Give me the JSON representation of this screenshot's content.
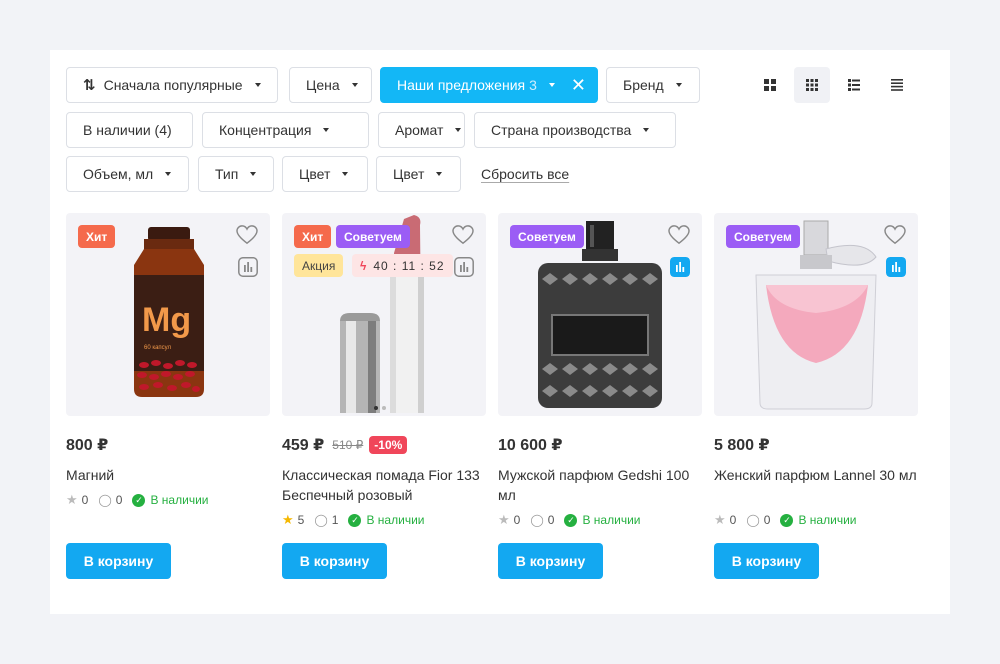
{
  "filters": {
    "sort": "Сначала популярные",
    "price": "Цена",
    "offers": "Наши предложения",
    "offers_count": "3",
    "brand": "Бренд",
    "in_stock": "В наличии (4)",
    "concentration": "Концентрация",
    "aroma": "Аромат",
    "country": "Страна производства",
    "volume": "Объем, мл",
    "type": "Тип",
    "color1": "Цвет",
    "color2": "Цвет",
    "reset": "Сбросить все"
  },
  "view_modes": [
    "grid-large",
    "grid-small",
    "list",
    "compact-list"
  ],
  "accent_color": "#13a8f1",
  "products": [
    {
      "badges": [
        "Хит"
      ],
      "price": "800 ₽",
      "name": "Магний",
      "rating": "0",
      "reviews": "0",
      "stock": "В наличии",
      "cart": "В корзину"
    },
    {
      "badges": [
        "Хит",
        "Советуем"
      ],
      "promo": "Акция",
      "timer": "40 : 11 : 52",
      "price": "459 ₽",
      "old_price": "510 ₽",
      "discount": "-10%",
      "name": "Классическая помада Fior 133 Беспечный розовый",
      "rating": "5",
      "reviews": "1",
      "stock": "В наличии",
      "cart": "В корзину"
    },
    {
      "badges": [
        "Советуем"
      ],
      "price": "10 600 ₽",
      "name": "Мужской парфюм Gedshi 100 мл",
      "rating": "0",
      "reviews": "0",
      "stock": "В наличии",
      "cart": "В корзину"
    },
    {
      "badges": [
        "Советуем"
      ],
      "price": "5 800 ₽",
      "name": "Женский парфюм Lannel 30 мл",
      "rating": "0",
      "reviews": "0",
      "stock": "В наличии",
      "cart": "В корзину"
    }
  ],
  "product_image_text": {
    "mg": "Mg",
    "capsules": "60 капсул"
  }
}
